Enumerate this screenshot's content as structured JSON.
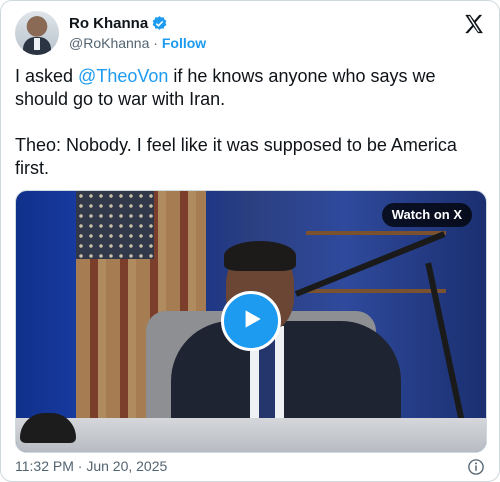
{
  "author": {
    "name": "Ro Khanna",
    "handle": "@RoKhanna",
    "separator": "·",
    "follow_label": "Follow"
  },
  "tweet": {
    "before_mention": "I asked ",
    "mention": "@TheoVon",
    "after_mention": " if he knows anyone who says we should go to war with Iran.\n\nTheo: Nobody. I feel like it was supposed to be America first."
  },
  "media": {
    "watch_label": "Watch on X"
  },
  "footer": {
    "timestamp": "11:32 PM · Jun 20, 2025"
  },
  "icons": {
    "verified": "verified-badge-icon",
    "platform": "x-logo-icon",
    "play": "play-icon",
    "info": "info-icon"
  },
  "colors": {
    "accent": "#1d9bf0",
    "text": "#0f1419",
    "muted": "#536471"
  }
}
